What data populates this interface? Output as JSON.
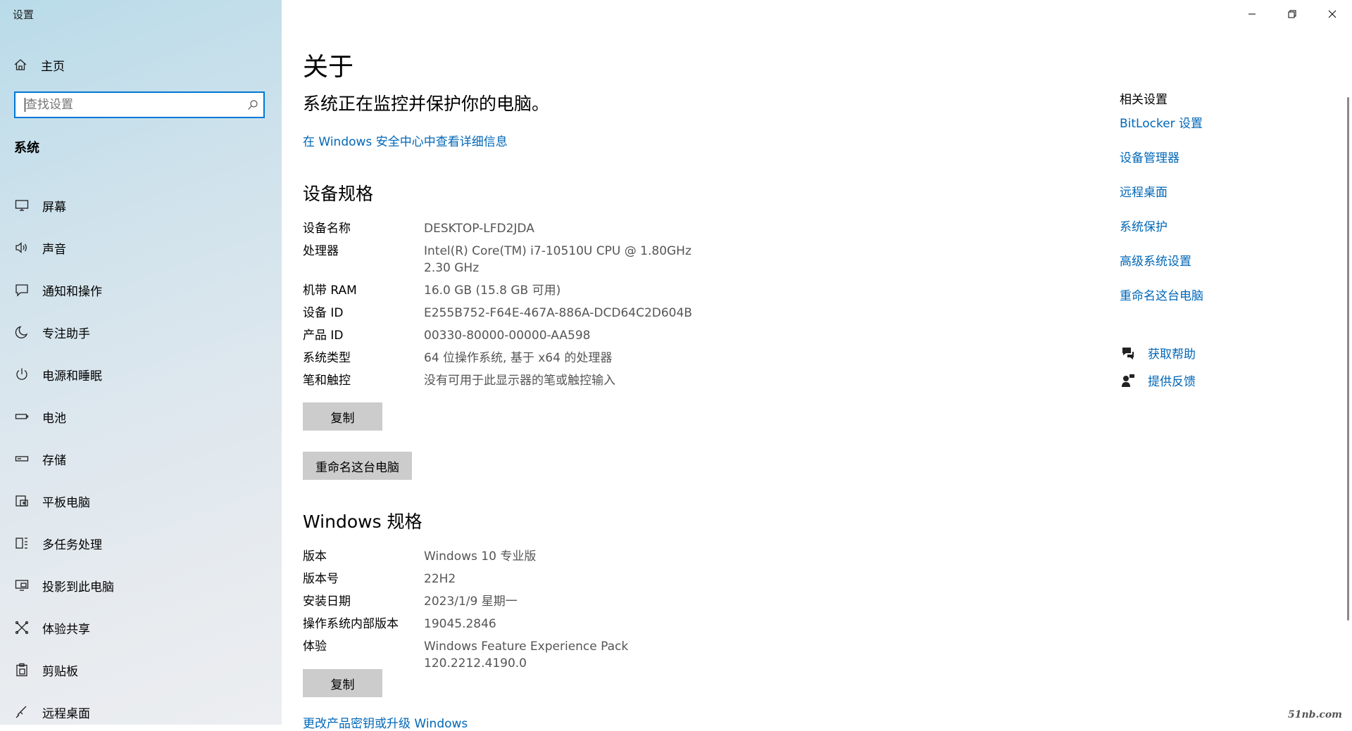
{
  "window": {
    "title": "设置"
  },
  "sidebar": {
    "home_label": "主页",
    "search_placeholder": "查找设置",
    "section_title": "系统",
    "items": [
      {
        "label": "屏幕",
        "icon": "monitor-icon"
      },
      {
        "label": "声音",
        "icon": "speaker-icon"
      },
      {
        "label": "通知和操作",
        "icon": "notification-icon"
      },
      {
        "label": "专注助手",
        "icon": "moon-icon"
      },
      {
        "label": "电源和睡眠",
        "icon": "power-icon"
      },
      {
        "label": "电池",
        "icon": "battery-icon"
      },
      {
        "label": "存储",
        "icon": "storage-icon"
      },
      {
        "label": "平板电脑",
        "icon": "tablet-icon"
      },
      {
        "label": "多任务处理",
        "icon": "multitask-icon"
      },
      {
        "label": "投影到此电脑",
        "icon": "project-icon"
      },
      {
        "label": "体验共享",
        "icon": "share-icon"
      },
      {
        "label": "剪贴板",
        "icon": "clipboard-icon"
      },
      {
        "label": "远程桌面",
        "icon": "remote-desktop-icon"
      }
    ]
  },
  "main": {
    "title": "关于",
    "status": "系统正在监控并保护你的电脑。",
    "security_link": "在 Windows 安全中心中查看详细信息",
    "device_specs": {
      "heading": "设备规格",
      "rows": [
        {
          "key": "设备名称",
          "value": "DESKTOP-LFD2JDA"
        },
        {
          "key": "处理器",
          "value": "Intel(R) Core(TM) i7-10510U CPU @ 1.80GHz   2.30 GHz"
        },
        {
          "key": "机带 RAM",
          "value": "16.0 GB (15.8 GB 可用)"
        },
        {
          "key": "设备 ID",
          "value": "E255B752-F64E-467A-886A-DCD64C2D604B"
        },
        {
          "key": "产品 ID",
          "value": "00330-80000-00000-AA598"
        },
        {
          "key": "系统类型",
          "value": "64 位操作系统, 基于 x64 的处理器"
        },
        {
          "key": "笔和触控",
          "value": "没有可用于此显示器的笔或触控输入"
        }
      ],
      "copy_label": "复制",
      "rename_label": "重命名这台电脑"
    },
    "windows_specs": {
      "heading": "Windows 规格",
      "rows": [
        {
          "key": "版本",
          "value": "Windows 10 专业版"
        },
        {
          "key": "版本号",
          "value": "22H2"
        },
        {
          "key": "安装日期",
          "value": "2023/1/9 星期一"
        },
        {
          "key": "操作系统内部版本",
          "value": "19045.2846"
        },
        {
          "key": "体验",
          "value": "Windows Feature Experience Pack 120.2212.4190.0"
        }
      ],
      "copy_label": "复制"
    },
    "bottom_link": "更改产品密钥或升级 Windows"
  },
  "related": {
    "title": "相关设置",
    "links": [
      "BitLocker 设置",
      "设备管理器",
      "远程桌面",
      "系统保护",
      "高级系统设置",
      "重命名这台电脑"
    ],
    "help": {
      "get_help": "获取帮助",
      "feedback": "提供反馈"
    }
  },
  "watermark": "51nb.com",
  "colors": {
    "accent": "#0078d4",
    "link": "#0067b8",
    "button": "#cccccc"
  }
}
